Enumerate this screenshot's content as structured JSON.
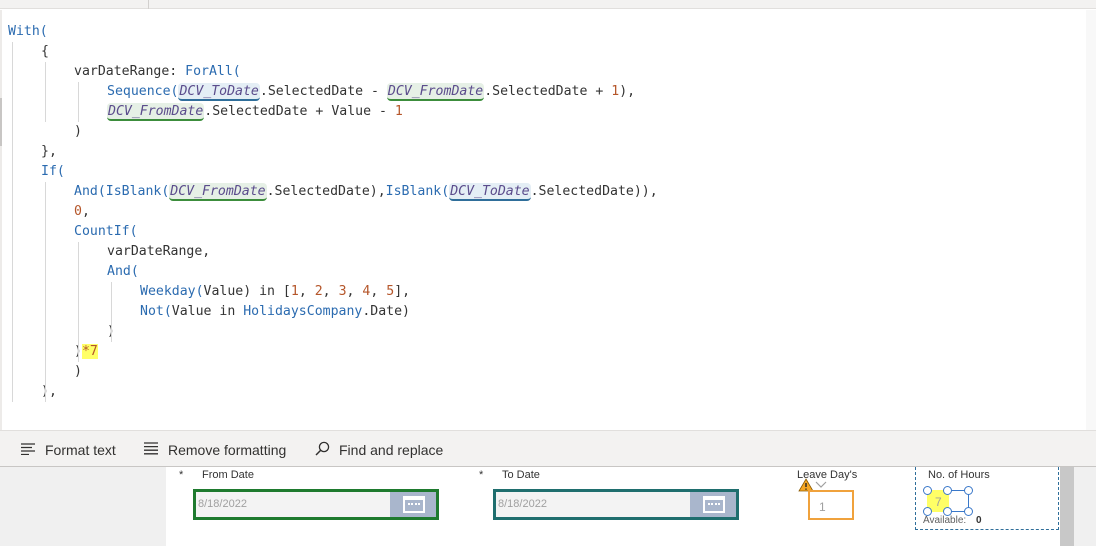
{
  "code_lines": [
    {
      "i": 0,
      "tokens": [
        {
          "t": "With(",
          "c": "kw"
        }
      ]
    },
    {
      "i": 1,
      "tokens": [
        {
          "t": "{",
          "c": ""
        }
      ]
    },
    {
      "i": 2,
      "tokens": [
        {
          "t": "varDateRange: ",
          "c": ""
        },
        {
          "t": "ForAll(",
          "c": "kw"
        }
      ]
    },
    {
      "i": 3,
      "tokens": [
        {
          "t": "Sequence(",
          "c": "kw"
        },
        {
          "t": "DCV_ToDate",
          "c": "ctl ctl-to"
        },
        {
          "t": ".SelectedDate - ",
          "c": ""
        },
        {
          "t": "DCV_FromDate",
          "c": "ctl ctl-from"
        },
        {
          "t": ".SelectedDate + ",
          "c": ""
        },
        {
          "t": "1",
          "c": "num"
        },
        {
          "t": "),",
          "c": ""
        }
      ]
    },
    {
      "i": 3,
      "tokens": [
        {
          "t": "DCV_FromDate",
          "c": "ctl ctl-from"
        },
        {
          "t": ".SelectedDate + Value - ",
          "c": ""
        },
        {
          "t": "1",
          "c": "num"
        }
      ]
    },
    {
      "i": 2,
      "tokens": [
        {
          "t": ")",
          "c": ""
        }
      ]
    },
    {
      "i": 1,
      "tokens": [
        {
          "t": "},",
          "c": ""
        }
      ]
    },
    {
      "i": 1,
      "tokens": [
        {
          "t": "If(",
          "c": "kw"
        }
      ]
    },
    {
      "i": 2,
      "tokens": [
        {
          "t": "And(",
          "c": "kw"
        },
        {
          "t": "IsBlank(",
          "c": "kw"
        },
        {
          "t": "DCV_FromDate",
          "c": "ctl ctl-from"
        },
        {
          "t": ".SelectedDate),",
          "c": ""
        },
        {
          "t": "IsBlank(",
          "c": "kw"
        },
        {
          "t": "DCV_ToDate",
          "c": "ctl ctl-to"
        },
        {
          "t": ".SelectedDate)),",
          "c": ""
        }
      ]
    },
    {
      "i": 2,
      "tokens": [
        {
          "t": "0",
          "c": "num"
        },
        {
          "t": ",",
          "c": ""
        }
      ]
    },
    {
      "i": 2,
      "tokens": [
        {
          "t": "CountIf(",
          "c": "kw"
        }
      ]
    },
    {
      "i": 3,
      "tokens": [
        {
          "t": "varDateRange,",
          "c": ""
        }
      ]
    },
    {
      "i": 3,
      "tokens": [
        {
          "t": "And(",
          "c": "kw"
        }
      ]
    },
    {
      "i": 4,
      "tokens": [
        {
          "t": "Weekday(",
          "c": "kw"
        },
        {
          "t": "Value) in [",
          "c": ""
        },
        {
          "t": "1",
          "c": "num"
        },
        {
          "t": ", ",
          "c": ""
        },
        {
          "t": "2",
          "c": "num"
        },
        {
          "t": ", ",
          "c": ""
        },
        {
          "t": "3",
          "c": "num"
        },
        {
          "t": ", ",
          "c": ""
        },
        {
          "t": "4",
          "c": "num"
        },
        {
          "t": ", ",
          "c": ""
        },
        {
          "t": "5",
          "c": "num"
        },
        {
          "t": "],",
          "c": ""
        }
      ]
    },
    {
      "i": 4,
      "tokens": [
        {
          "t": "Not(",
          "c": "kw"
        },
        {
          "t": "Value in ",
          "c": ""
        },
        {
          "t": "HolidaysCompany",
          "c": "kw"
        },
        {
          "t": ".Date)",
          "c": ""
        }
      ]
    },
    {
      "i": 3,
      "tokens": [
        {
          "t": ")",
          "c": ""
        }
      ]
    },
    {
      "i": 2,
      "tokens": [
        {
          "t": ")",
          "c": ""
        },
        {
          "t": "*7",
          "c": "hl"
        }
      ]
    },
    {
      "i": 2,
      "tokens": [
        {
          "t": ")",
          "c": ""
        }
      ]
    },
    {
      "i": 1,
      "tokens": [
        {
          "t": "),",
          "c": ""
        }
      ]
    }
  ],
  "toolbar": {
    "format_text": "Format text",
    "remove_formatting": "Remove formatting",
    "find_replace": "Find and replace"
  },
  "form": {
    "required_mark": "*",
    "from_date_label": "From Date",
    "from_date_value": "8/18/2022",
    "to_date_label": "To Date",
    "to_date_value": "8/18/2022",
    "leave_days_label": "Leave Day's",
    "leave_days_value": "1",
    "hours_label": "No. of Hours",
    "hours_value": "7",
    "available_label": "Available:",
    "available_value": "0"
  },
  "colors": {
    "from_date_border": "#1e7a2e",
    "to_date_border": "#1f6e6e",
    "leave_box_border": "#f0a23c",
    "highlight": "#ffff66"
  },
  "icons": [
    "format-text-icon",
    "remove-formatting-icon",
    "search-icon",
    "calendar-icon",
    "warning-icon",
    "chevron-down-icon"
  ]
}
